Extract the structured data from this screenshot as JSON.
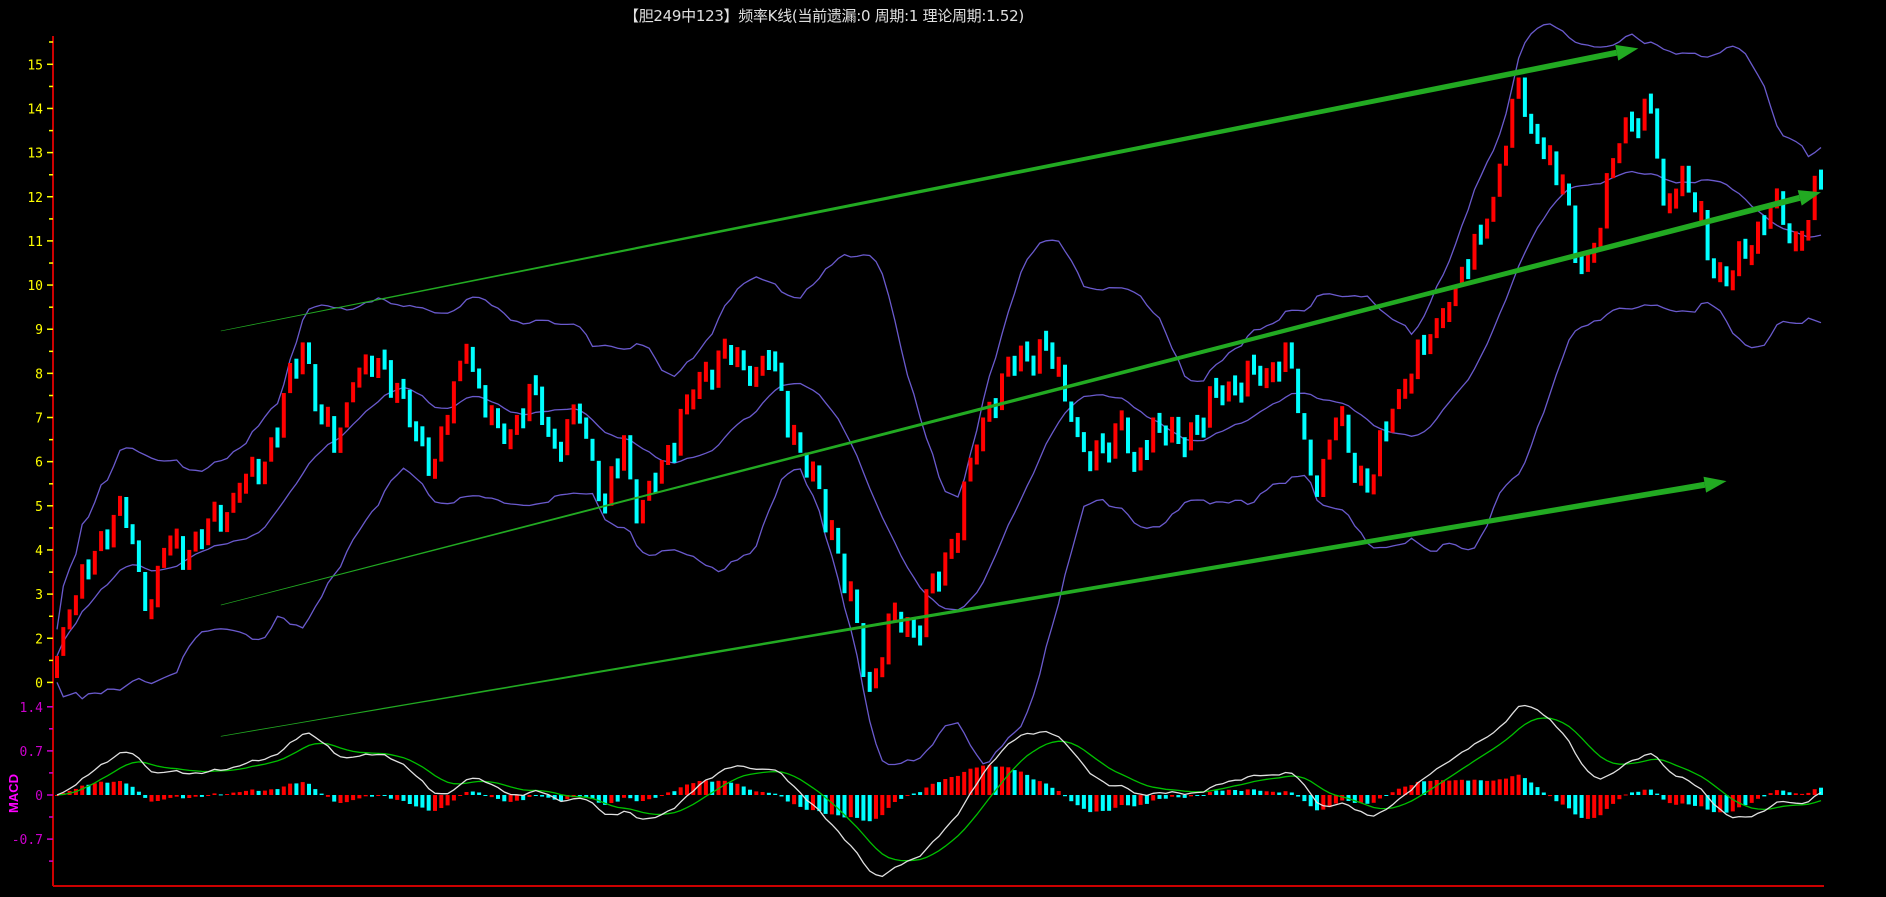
{
  "title": "【胆249中123】频率K线(当前遗漏:0 周期:1 理论周期:1.52)",
  "colors": {
    "up": "#ff0000",
    "down": "#00ffff",
    "band": "#6a5acd",
    "axis": "#cc0000",
    "price_tick": "#ffff00",
    "macd_tick": "#cc00cc",
    "dif": "#e0e0e0",
    "dea": "#00c000",
    "trend": "#22aa22"
  },
  "chart_data": [
    {
      "type": "candlestick",
      "name": "频率K线",
      "y_tick_labels": [
        "15",
        "14",
        "13",
        "12",
        "11",
        "10",
        "9",
        "8",
        "7",
        "6",
        "5",
        "4",
        "3",
        "2",
        "0"
      ],
      "candle_count": 281,
      "close_keypoints": [
        [
          0,
          1.6
        ],
        [
          2,
          2.6
        ],
        [
          10,
          5.2
        ],
        [
          13,
          3.5
        ],
        [
          15,
          2.7
        ],
        [
          17,
          4.0
        ],
        [
          21,
          4.0
        ],
        [
          29,
          5.3
        ],
        [
          33,
          6.0
        ],
        [
          39,
          8.7
        ],
        [
          42,
          7.0
        ],
        [
          44,
          6.2
        ],
        [
          47,
          7.8
        ],
        [
          52,
          8.3
        ],
        [
          57,
          6.6
        ],
        [
          60,
          6.0
        ],
        [
          65,
          8.6
        ],
        [
          68,
          7.0
        ],
        [
          71,
          6.4
        ],
        [
          76,
          7.7
        ],
        [
          79,
          6.3
        ],
        [
          83,
          7.0
        ],
        [
          87,
          5.0
        ],
        [
          90,
          6.6
        ],
        [
          92,
          4.6
        ],
        [
          95,
          5.5
        ],
        [
          100,
          7.4
        ],
        [
          106,
          8.6
        ],
        [
          110,
          7.8
        ],
        [
          113,
          8.3
        ],
        [
          118,
          6.2
        ],
        [
          123,
          4.5
        ],
        [
          129,
          0.9
        ],
        [
          133,
          2.6
        ],
        [
          136,
          2.1
        ],
        [
          142,
          4.1
        ],
        [
          147,
          7.0
        ],
        [
          150,
          8.0
        ],
        [
          157,
          8.7
        ],
        [
          161,
          6.9
        ],
        [
          164,
          5.8
        ],
        [
          169,
          7.0
        ],
        [
          171,
          5.8
        ],
        [
          174,
          7.0
        ],
        [
          178,
          6.4
        ],
        [
          186,
          7.8
        ],
        [
          192,
          8.0
        ],
        [
          195,
          8.7
        ],
        [
          198,
          6.5
        ],
        [
          200,
          5.2
        ],
        [
          203,
          7.0
        ],
        [
          208,
          5.3
        ],
        [
          212,
          7.2
        ],
        [
          218,
          8.8
        ],
        [
          222,
          10.0
        ],
        [
          228,
          12.0
        ],
        [
          232,
          14.7
        ],
        [
          234,
          13.5
        ],
        [
          239,
          12.3
        ],
        [
          241,
          10.5
        ],
        [
          243,
          10.6
        ],
        [
          249,
          13.8
        ],
        [
          253,
          14.0
        ],
        [
          255,
          11.8
        ],
        [
          258,
          12.7
        ],
        [
          263,
          10.2
        ],
        [
          266,
          10.2
        ],
        [
          272,
          11.8
        ],
        [
          276,
          11.0
        ],
        [
          280,
          12.3
        ]
      ],
      "overlays": [
        "bollinger upper",
        "bollinger middle",
        "bollinger lower"
      ],
      "trend_arrows": [
        {
          "points": [
            [
              26,
              8.96
            ],
            [
              251,
              15.36
            ]
          ]
        },
        {
          "points": [
            [
              26,
              2.75
            ],
            [
              280,
              12.1
            ]
          ]
        },
        {
          "points": [
            [
              26,
              -0.22
            ],
            [
              129,
              2.29
            ],
            [
              265,
              5.56
            ]
          ]
        }
      ]
    },
    {
      "type": "macd",
      "label": "MACD",
      "y_ticks": [
        {
          "label": "1.4",
          "value": 1.4
        },
        {
          "label": "0.7",
          "value": 0.7
        },
        {
          "label": "0",
          "value": 0
        },
        {
          "label": "-0.7",
          "value": -0.7
        }
      ],
      "series": [
        "DIF",
        "DEA",
        "MACD histogram"
      ]
    }
  ]
}
